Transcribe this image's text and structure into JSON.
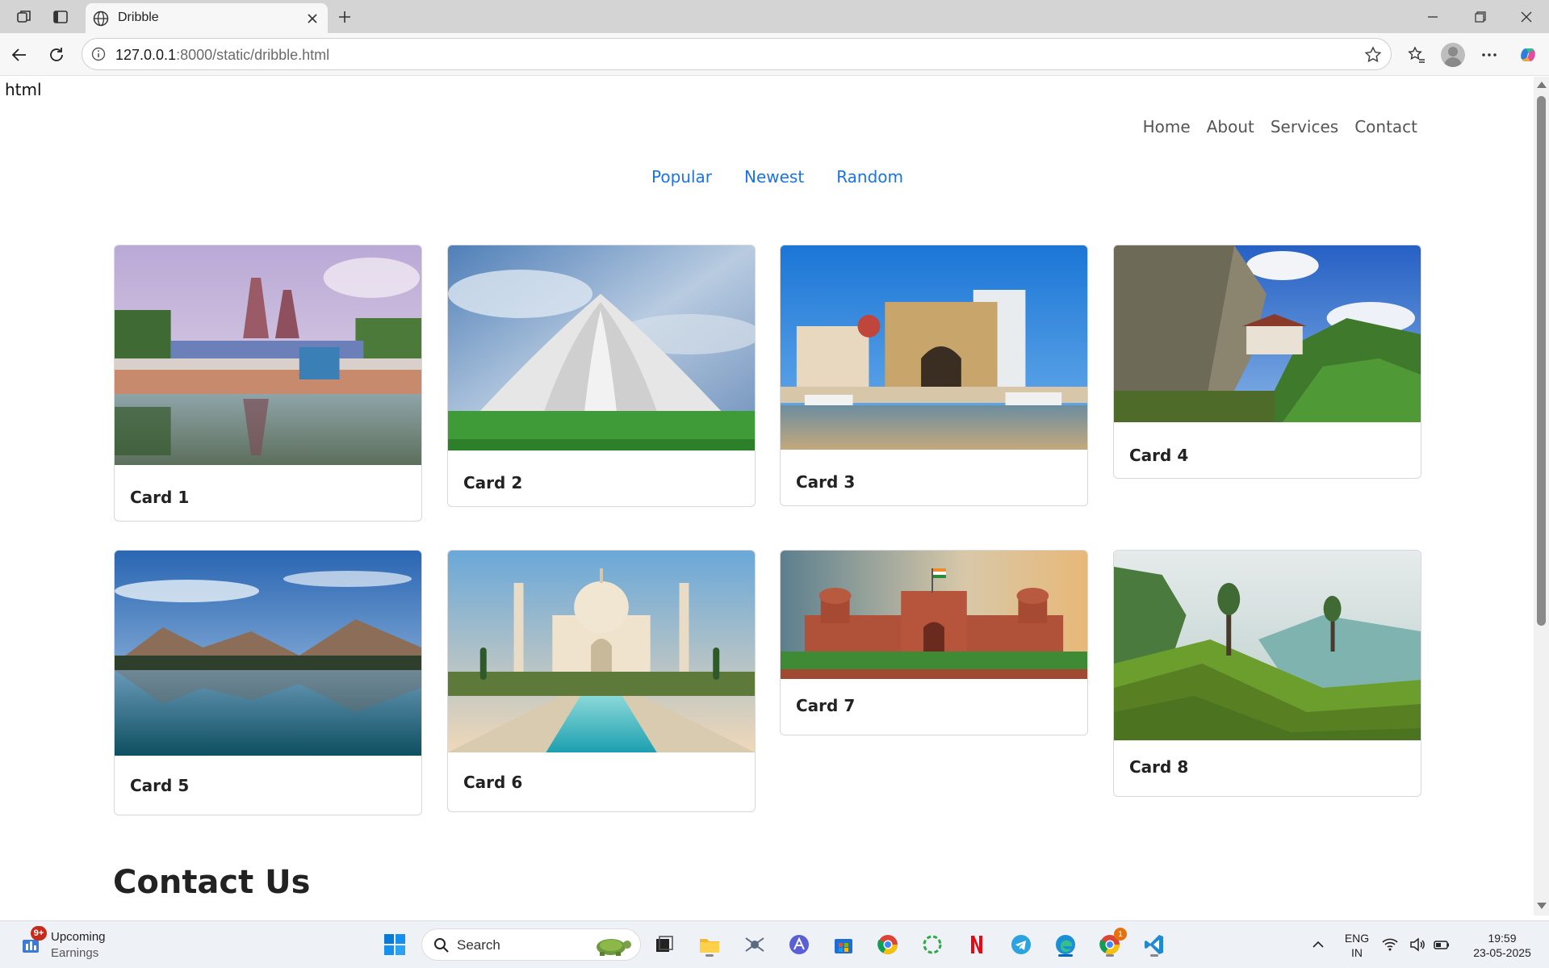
{
  "browser": {
    "tab_title": "Dribble",
    "url_host": "127.0.0.1",
    "url_rest": ":8000/static/dribble.html"
  },
  "page": {
    "raw_text": "html",
    "nav": [
      "Home",
      "About",
      "Services",
      "Contact"
    ],
    "filters": [
      "Popular",
      "Newest",
      "Random"
    ],
    "cards": [
      {
        "title": "Card 1",
        "image": "temple-tank"
      },
      {
        "title": "Card 2",
        "image": "lotus-temple"
      },
      {
        "title": "Card 3",
        "image": "gateway-of-india"
      },
      {
        "title": "Card 4",
        "image": "cliff-monastery"
      },
      {
        "title": "Card 5",
        "image": "mountain-lake"
      },
      {
        "title": "Card 6",
        "image": "taj-mahal"
      },
      {
        "title": "Card 7",
        "image": "red-fort"
      },
      {
        "title": "Card 8",
        "image": "tea-plantation"
      }
    ],
    "contact_heading": "Contact Us"
  },
  "taskbar": {
    "widget_title": "Upcoming",
    "widget_subtitle": "Earnings",
    "widget_badge": "9+",
    "search_label": "Search",
    "chrome_badge": "1",
    "lang_top": "ENG",
    "lang_bottom": "IN",
    "time": "19:59",
    "date": "23-05-2025"
  }
}
